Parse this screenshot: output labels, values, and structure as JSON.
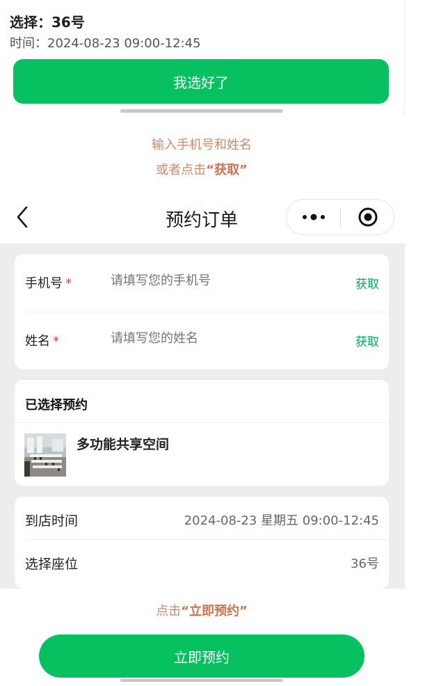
{
  "top_panel": {
    "selection_label": "选择：36号",
    "time_label": "时间：2024-08-23 09:00-12:45",
    "confirm_button": "我选好了"
  },
  "hints": {
    "line1": "输入手机号和姓名",
    "line2_prefix": "或者点击",
    "line2_highlight": "“获取”",
    "line3_prefix": "点击",
    "line3_highlight": "“立即预约”"
  },
  "nav": {
    "title": "预约订单",
    "back_icon": "chevron-left-icon",
    "more_icon": "more-dots-icon",
    "close_icon": "target-circle-icon"
  },
  "form": {
    "phone": {
      "label": "手机号",
      "required_mark": "*",
      "placeholder": "请填写您的手机号",
      "action": "获取"
    },
    "name": {
      "label": "姓名",
      "required_mark": "*",
      "placeholder": "请填写您的姓名",
      "action": "获取"
    }
  },
  "selected": {
    "title": "已选择预约",
    "venue_name": "多功能共享空间"
  },
  "details": {
    "arrival_label": "到店时间",
    "arrival_value": "2024-08-23 星期五 09:00-12:45",
    "seat_label": "选择座位",
    "seat_value": "36号"
  },
  "book_button": "立即预约",
  "colors": {
    "primary_green": "#07c160",
    "link_green": "#07a85a",
    "hint_orange": "#cf8a6a",
    "required_red": "#e64340",
    "page_gray": "#ededed"
  }
}
